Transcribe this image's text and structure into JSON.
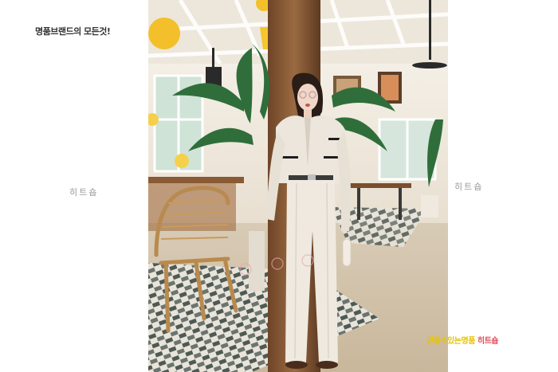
{
  "header": {
    "tagline": "명품브랜드의 모든것!"
  },
  "watermarks": {
    "left": "히트숍",
    "right": "히트숍"
  },
  "footer": {
    "slogan_part1": "믿을수있는명품 ",
    "slogan_part2": "히트숍"
  },
  "colors": {
    "background": "#ffffff",
    "slogan_yellow": "#e8c400",
    "slogan_red": "#e24f5c",
    "watermark_gray": "#9a9a9a",
    "outfit_cream": "#ece6dc"
  }
}
